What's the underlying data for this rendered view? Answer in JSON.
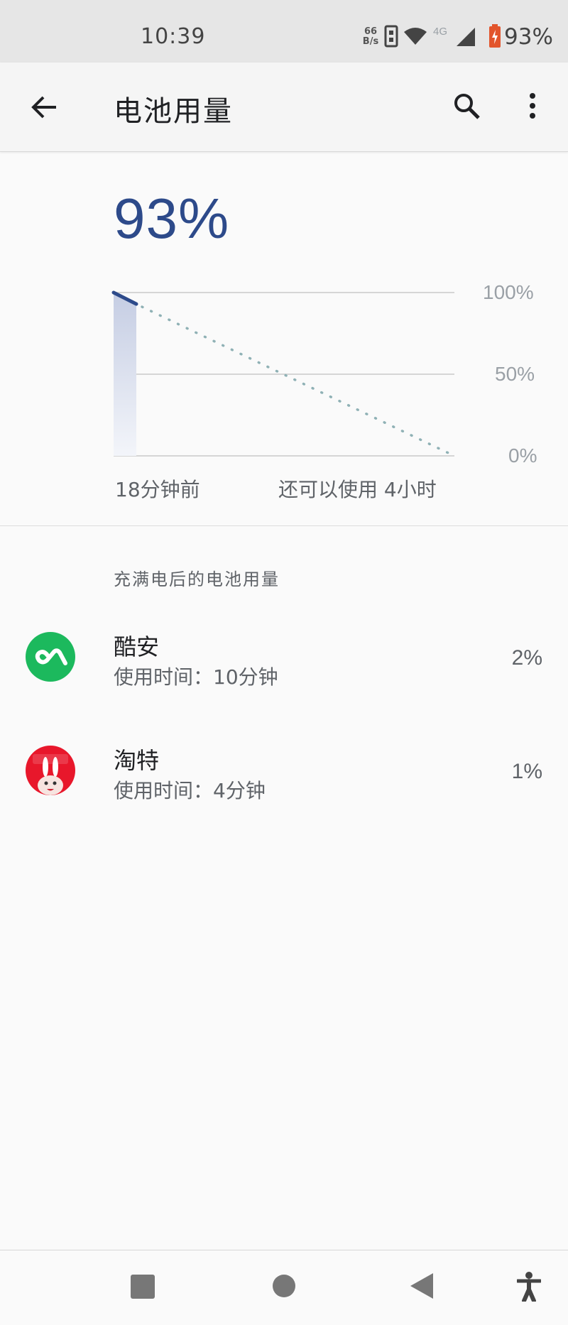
{
  "status_bar": {
    "time": "10:39",
    "net_speed_value": "66",
    "net_speed_unit": "B/s",
    "network_type": "4G",
    "battery_percent": "93%",
    "icons": [
      "vibrate-icon",
      "wifi-icon",
      "cell-signal-icon",
      "battery-charging-icon"
    ]
  },
  "app_bar": {
    "title": "电池用量",
    "back_icon": "arrow-back-icon",
    "search_icon": "search-icon",
    "more_icon": "more-vert-icon"
  },
  "summary": {
    "battery_level": "93%"
  },
  "chart_data": {
    "type": "line",
    "y_ticks": [
      "100%",
      "50%",
      "0%"
    ],
    "ylim": [
      0,
      100
    ],
    "x_start_label": "18分钟前",
    "x_end_label": "还可以使用 4小时",
    "series": [
      {
        "values_pct": [
          100,
          93
        ],
        "style": "solid"
      },
      {
        "values_pct": [
          93,
          0
        ],
        "style": "dotted-projection"
      }
    ],
    "accent": "#2d4a8a",
    "projection_color": "#8fb1b5"
  },
  "usage_section": {
    "header": "充满电后的电池用量",
    "apps": [
      {
        "name": "酷安",
        "usage": "使用时间：10分钟",
        "percent": "2%",
        "icon": "coolapk-icon",
        "icon_color": "#1cb95d"
      },
      {
        "name": "淘特",
        "usage": "使用时间：4分钟",
        "percent": "1%",
        "icon": "taote-icon",
        "icon_color": "#e8172b"
      }
    ]
  },
  "nav_bar": {
    "icons": [
      "recents-icon",
      "home-icon",
      "back-icon",
      "accessibility-icon"
    ]
  }
}
